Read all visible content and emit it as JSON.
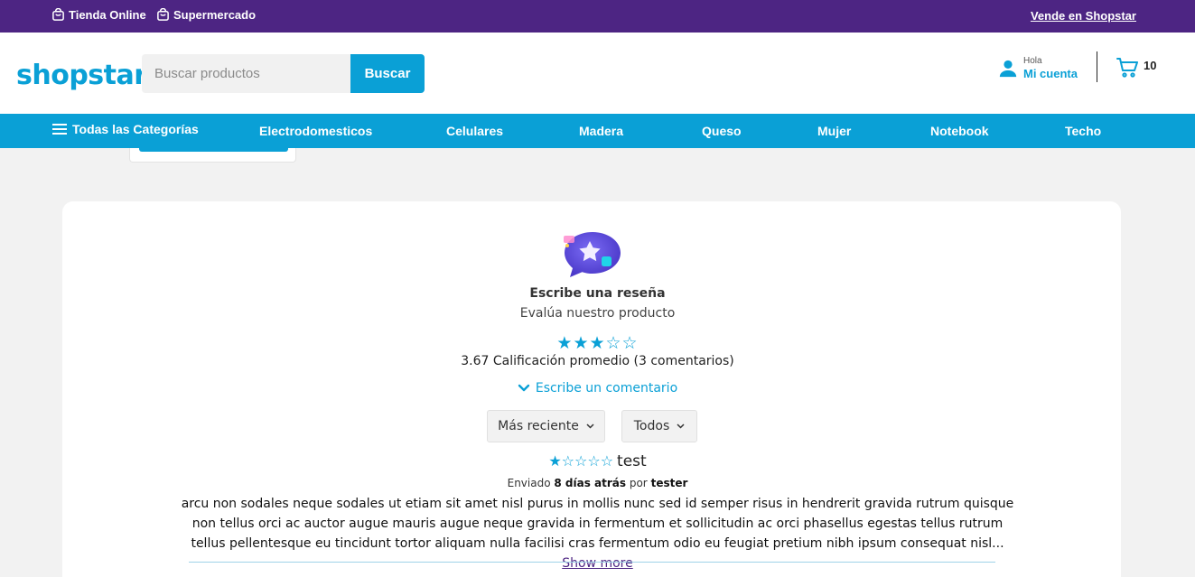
{
  "topbar": {
    "links": [
      "Tienda Online",
      "Supermercado"
    ],
    "sell_link": "Vende en Shopstar",
    "bg_color": "#4d2583"
  },
  "header": {
    "logo": "shopstar",
    "logo_dot": ".",
    "search": {
      "placeholder": "Buscar productos",
      "button_label": "Buscar"
    },
    "account": {
      "greeting": "Hola",
      "label": "Mi cuenta"
    },
    "cart": {
      "count": "10",
      "icon": "cart-icon"
    },
    "accent_color": "#0aa0d6"
  },
  "nav": {
    "all_categories": "Todas las Categorías",
    "items": [
      "Electrodomesticos",
      "Celulares",
      "Madera",
      "Queso",
      "Mujer",
      "Notebook",
      "Techo"
    ]
  },
  "reviews": {
    "title": "Escribe una reseña",
    "subtitle": "Evalúa nuestro producto",
    "rating_stars": "★★★☆☆",
    "average_text": "3.67 Calificación promedio (3 comentarios)",
    "write_comment": "Escribe un comentario",
    "sort_options": {
      "sort_selected": "Más reciente",
      "filter_selected": "Todos"
    },
    "items": [
      {
        "stars": "★☆☆☆☆",
        "title": "test",
        "sent_prefix": "Enviado",
        "time": "8 días atrás",
        "by": "por",
        "author": "tester",
        "body": "arcu non sodales neque sodales ut etiam sit amet nisl purus in mollis nunc sed id semper risus in hendrerit gravida rutrum quisque non tellus orci ac auctor augue mauris augue neque gravida in fermentum et sollicitudin ac orci phasellus egestas tellus rutrum tellus pellentesque eu tincidunt tortor aliquam nulla facilisi cras fermentum odio eu feugiat pretium nibh ipsum consequat nisl...",
        "show_more": "Show more"
      }
    ]
  }
}
